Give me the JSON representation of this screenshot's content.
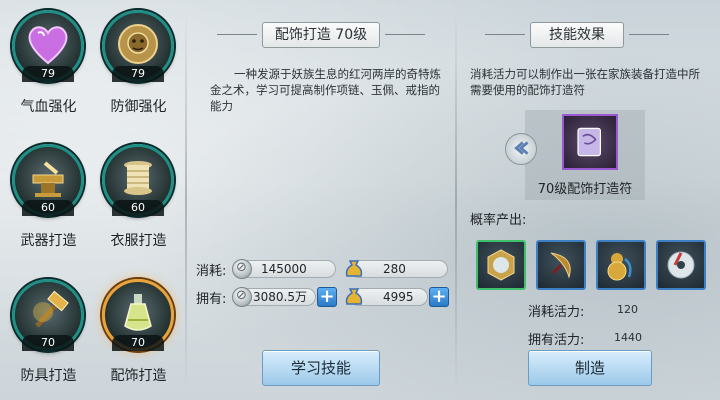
{
  "skills": [
    {
      "name": "气血强化",
      "level": "79",
      "icon": "purple-heart-icon"
    },
    {
      "name": "防御强化",
      "level": "79",
      "icon": "lion-shield-icon"
    },
    {
      "name": "武器打造",
      "level": "60",
      "icon": "anvil-icon"
    },
    {
      "name": "衣服打造",
      "level": "60",
      "icon": "thread-spool-icon"
    },
    {
      "name": "防具打造",
      "level": "70",
      "icon": "hammer-icon"
    },
    {
      "name": "配饰打造",
      "level": "70",
      "icon": "potion-bottle-icon",
      "selected": true
    }
  ],
  "middle": {
    "title": "配饰打造 70级",
    "description": "一种发源于妖族生息的红河两岸的奇特炼金之术，学习可提高制作项链、玉佩、戒指的能力",
    "cost_label": "消耗:",
    "cost_silver": "145000",
    "cost_points": "280",
    "own_label": "拥有:",
    "own_silver": "3080.5万",
    "own_points": "4995",
    "learn_button": "学习技能"
  },
  "right": {
    "title": "技能效果",
    "description": "消耗活力可以制作出一张在家族装备打造中所需要使用的配饰打造符",
    "product_name": "70级配饰打造符",
    "drop_label": "概率产出:",
    "drops": [
      "mirror-icon",
      "moon-blade-icon",
      "gourd-icon",
      "jade-ring-icon"
    ],
    "vitality_cost_label": "消耗活力:",
    "vitality_cost": "120",
    "vitality_own_label": "拥有活力:",
    "vitality_own": "1440",
    "make_button": "制造"
  },
  "colors": {
    "ring": "#1f8f86",
    "selected_ring": "#e8a33a",
    "button": "#9cc9ea",
    "plus": "#2b79c6",
    "slot_border": "#3c7fc4"
  }
}
